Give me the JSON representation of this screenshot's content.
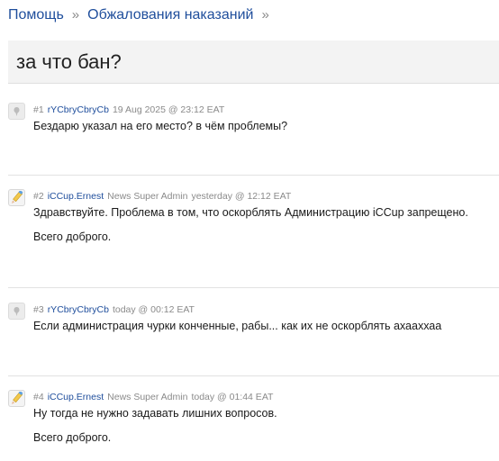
{
  "breadcrumb": {
    "items": [
      "Помощь",
      "Обжалования наказаний"
    ],
    "separator": "»"
  },
  "thread": {
    "title": "за что бан?"
  },
  "posts": [
    {
      "num": "#1",
      "author": "rYCbryCbryCb",
      "role": "",
      "date": "19 Aug 2025 @ 23:12 EAT",
      "lines": [
        "Бездарю указал на его место? в чём проблемы?"
      ],
      "avatar": "user-avatar"
    },
    {
      "num": "#2",
      "author": "iCCup.Ernest",
      "role": "News Super Admin",
      "date": "yesterday @ 12:12 EAT",
      "lines": [
        "Здравствуйте. Проблема в том, что оскорблять Администрацию iCCup запрещено.",
        "Всего доброго."
      ],
      "avatar": "admin-avatar"
    },
    {
      "num": "#3",
      "author": "rYCbryCbryCb",
      "role": "",
      "date": "today @ 00:12 EAT",
      "lines": [
        "Если администрация чурки конченные, рабы... как их не оскорблять ахааххаа"
      ],
      "avatar": "user-avatar"
    },
    {
      "num": "#4",
      "author": "iCCup.Ernest",
      "role": "News Super Admin",
      "date": "today @ 01:44 EAT",
      "lines": [
        "Ну тогда не нужно задавать лишних вопросов.",
        "Всего доброго."
      ],
      "avatar": "admin-avatar"
    }
  ],
  "colors": {
    "link": "#1f4e9c",
    "meta": "#8a8a8a",
    "title_bg": "#f3f3f3"
  }
}
